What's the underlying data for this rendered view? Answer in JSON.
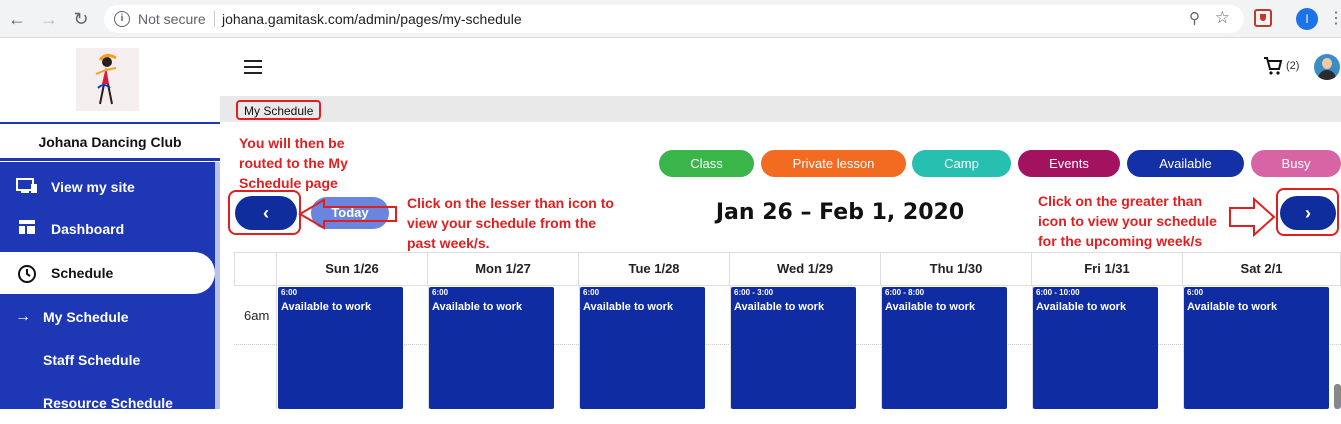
{
  "browser": {
    "security": "Not secure",
    "url": "johana.gamitask.com/admin/pages/my-schedule",
    "profile_initial": "I"
  },
  "brand": {
    "name": "Johana Dancing Club"
  },
  "sidebar": {
    "items": [
      {
        "label": "View my site",
        "icon": "monitor-icon"
      },
      {
        "label": "Dashboard",
        "icon": "dashboard-icon"
      },
      {
        "label": "Schedule",
        "icon": "clock-icon"
      },
      {
        "label": "My Schedule",
        "icon": "arrow-right-icon"
      },
      {
        "label": "Staff Schedule"
      },
      {
        "label": "Resource Schedule"
      }
    ]
  },
  "header": {
    "cart_count": "(2)"
  },
  "breadcrumb": "My Schedule",
  "annotations": {
    "routed": [
      "You will then be",
      "routed to the My",
      "Schedule page"
    ],
    "lesser": [
      "Click on the lesser than icon to",
      "view your schedule from the",
      "past week/s."
    ],
    "greater": [
      "Click on the greater than",
      "icon to view your schedule",
      "for the upcoming week/s"
    ]
  },
  "legend": [
    {
      "label": "Class",
      "color": "#3ab54a"
    },
    {
      "label": "Private lesson",
      "color": "#f26b21"
    },
    {
      "label": "Camp",
      "color": "#26bfb0"
    },
    {
      "label": "Events",
      "color": "#a3125f"
    },
    {
      "label": "Available",
      "color": "#1330a6"
    },
    {
      "label": "Busy",
      "color": "#d765a5"
    }
  ],
  "calendar": {
    "prev_icon": "‹",
    "next_icon": "›",
    "today_label": "Today",
    "range": "Jan 26 – Feb 1, 2020",
    "time_label": "6am",
    "days": [
      "Sun 1/26",
      "Mon 1/27",
      "Tue 1/28",
      "Wed 1/29",
      "Thu 1/30",
      "Fri 1/31",
      "Sat 2/1"
    ],
    "events": [
      {
        "time": "6:00",
        "title": "Available to work"
      },
      {
        "time": "6:00",
        "title": "Available to work"
      },
      {
        "time": "6:00",
        "title": "Available to work"
      },
      {
        "time": "6:00 - 3:00",
        "title": "Available to work"
      },
      {
        "time": "6:00 - 8:00",
        "title": "Available to work"
      },
      {
        "time": "6:00 - 10:00",
        "title": "Available to work"
      },
      {
        "time": "6:00",
        "title": "Available to work"
      }
    ]
  }
}
